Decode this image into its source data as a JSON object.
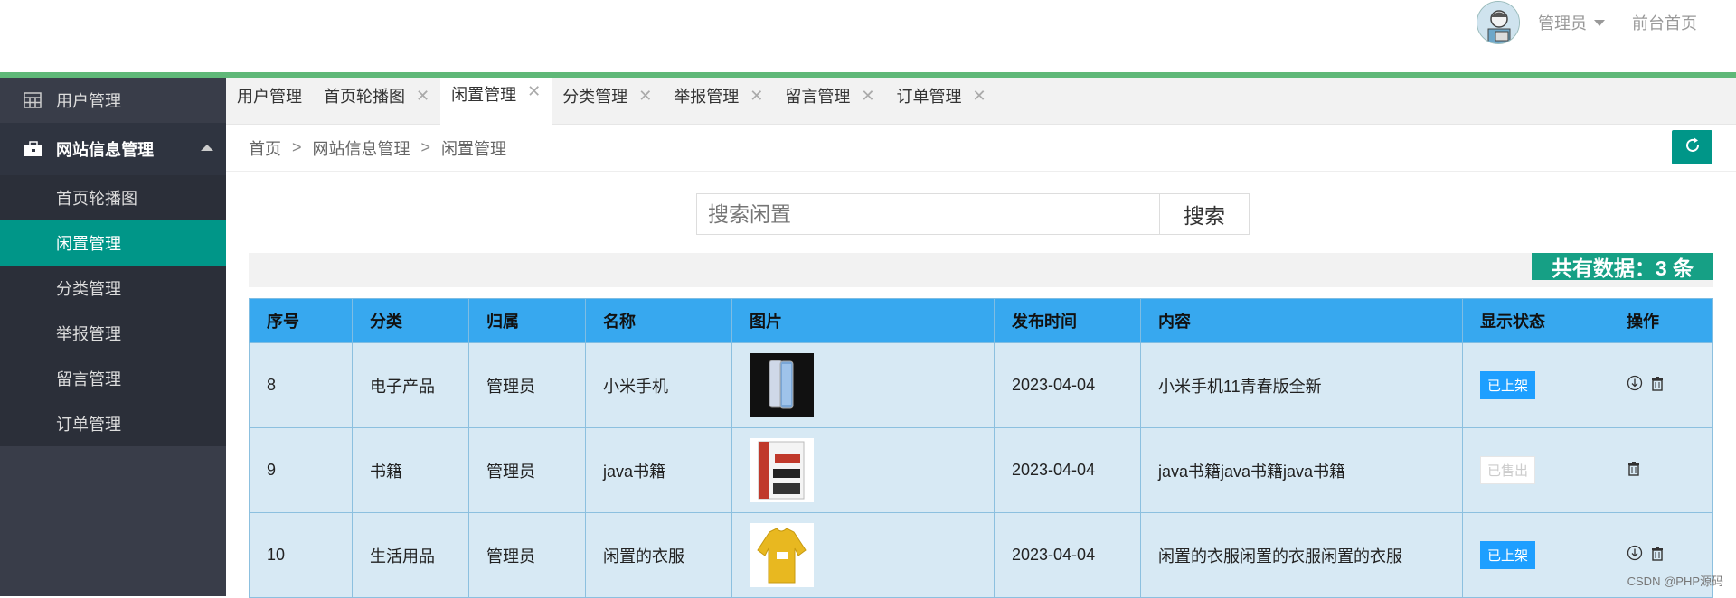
{
  "header": {
    "user_name": "管理员",
    "front_link": "前台首页"
  },
  "sidebar": {
    "items": [
      {
        "label": "用户管理",
        "icon": "table-grid-icon"
      },
      {
        "label": "网站信息管理",
        "icon": "briefcase-icon"
      }
    ],
    "sub_items": [
      {
        "label": "首页轮播图"
      },
      {
        "label": "闲置管理"
      },
      {
        "label": "分类管理"
      },
      {
        "label": "举报管理"
      },
      {
        "label": "留言管理"
      },
      {
        "label": "订单管理"
      }
    ]
  },
  "tabs": [
    {
      "label": "用户管理",
      "closable": false
    },
    {
      "label": "首页轮播图",
      "closable": true
    },
    {
      "label": "闲置管理",
      "closable": true,
      "active": true
    },
    {
      "label": "分类管理",
      "closable": true
    },
    {
      "label": "举报管理",
      "closable": true
    },
    {
      "label": "留言管理",
      "closable": true
    },
    {
      "label": "订单管理",
      "closable": true
    }
  ],
  "tab_close_glyph": "✕",
  "breadcrumb": {
    "items": [
      "首页",
      "网站信息管理",
      "闲置管理"
    ],
    "separator": ">"
  },
  "search": {
    "placeholder": "搜索闲置",
    "button_label": "搜索"
  },
  "total_label": "共有数据：3 条",
  "table": {
    "headers": [
      "序号",
      "分类",
      "归属",
      "名称",
      "图片",
      "发布时间",
      "内容",
      "显示状态",
      "操作"
    ],
    "rows": [
      {
        "id": "8",
        "category": "电子产品",
        "owner": "管理员",
        "name": "小米手机",
        "image": "phone-photo",
        "date": "2023-04-04",
        "content": "小米手机11青春版全新",
        "status": "已上架",
        "status_kind": "on"
      },
      {
        "id": "9",
        "category": "书籍",
        "owner": "管理员",
        "name": "java书籍",
        "image": "book-photo",
        "date": "2023-04-04",
        "content": "java书籍java书籍java书籍",
        "status": "已售出",
        "status_kind": "sold"
      },
      {
        "id": "10",
        "category": "生活用品",
        "owner": "管理员",
        "name": "闲置的衣服",
        "image": "sweater-photo",
        "date": "2023-04-04",
        "content": "闲置的衣服闲置的衣服闲置的衣服",
        "status": "已上架",
        "status_kind": "on"
      }
    ]
  },
  "watermark": "CSDN @PHP源码",
  "colors": {
    "accent_green": "#5fb878",
    "sidebar_bg": "#393d49",
    "active_teal": "#009688",
    "table_header": "#37a8ef",
    "badge_blue": "#1e9fff"
  }
}
